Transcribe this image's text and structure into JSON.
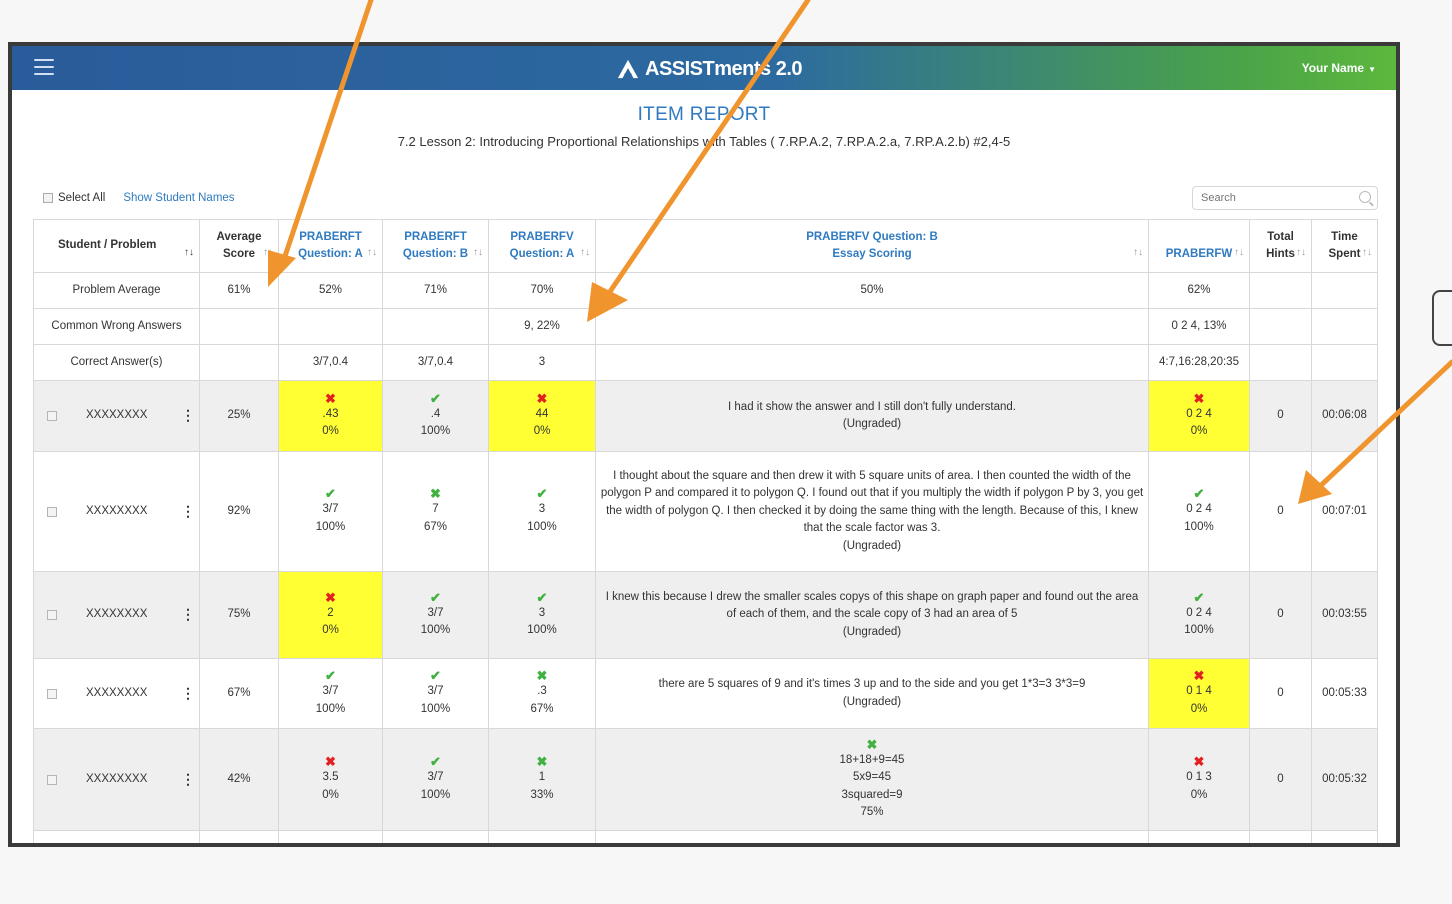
{
  "app": {
    "brand_bold": "ASSISTments",
    "brand_version": "2.0",
    "user_name": "Your Name"
  },
  "report": {
    "title": "ITEM REPORT",
    "subtitle": "7.2 Lesson 2: Introducing Proportional Relationships with Tables ( 7.RP.A.2, 7.RP.A.2.a, 7.RP.A.2.b) #2,4-5"
  },
  "controls": {
    "select_all": "Select All",
    "show_names": "Show Student Names",
    "search_placeholder": "Search"
  },
  "columns": {
    "student": "Student / Problem",
    "avg_l1": "Average",
    "avg_l2": "Score",
    "q1_l1": "PRABERFT",
    "q1_l2": "Question: A",
    "q2_l1": "PRABERFT",
    "q2_l2": "Question: B",
    "q3_l1": "PRABERFV",
    "q3_l2": "Question: A",
    "q4_l1": "PRABERFV Question: B",
    "q4_l2": "Essay Scoring",
    "q5": "PRABERFW",
    "hints_l1": "Total",
    "hints_l2": "Hints",
    "time_l1": "Time",
    "time_l2": "Spent",
    "sort_icon": "↑↓"
  },
  "summary": {
    "problem_average": {
      "label": "Problem Average",
      "avg": "61%",
      "q1": "52%",
      "q2": "71%",
      "q3": "70%",
      "q4": "50%",
      "q5": "62%"
    },
    "common_wrong": {
      "label": "Common Wrong Answers",
      "q3": "9, 22%",
      "q5": "0 2 4, 13%"
    },
    "correct": {
      "label": "Correct Answer(s)",
      "q1": "3/7,0.4",
      "q2": "3/7,0.4",
      "q3": "3",
      "q5": "4:7,16:28,20:35"
    }
  },
  "icons": {
    "check": "✔",
    "cross": "✖",
    "kebab": "⋮",
    "caret": "▼"
  },
  "students": [
    {
      "name": "XXXXXXXX",
      "avg": "25%",
      "q1": {
        "answer": ".43",
        "score": "0%"
      },
      "q2": {
        "answer": ".4",
        "score": "100%"
      },
      "q3": {
        "answer": "44",
        "score": "0%"
      },
      "q4": {
        "text": "I had it show the answer and I still don't fully understand.",
        "status": "(Ungraded)"
      },
      "q5": {
        "answer": "0 2 4",
        "score": "0%"
      },
      "hints": "0",
      "time": "00:06:08"
    },
    {
      "name": "XXXXXXXX",
      "avg": "92%",
      "q1": {
        "answer": "3/7",
        "score": "100%"
      },
      "q2": {
        "answer": "7",
        "score": "67%"
      },
      "q3": {
        "answer": "3",
        "score": "100%"
      },
      "q4": {
        "text": "I thought about the square and then drew it with 5 square units of area. I then counted the width of the polygon P and compared it to polygon Q. I found out that if you multiply the width if polygon P by 3, you get the width of polygon Q. I then checked it by doing the same thing with the length. Because of this, I knew that the scale factor was 3.",
        "status": "(Ungraded)"
      },
      "q5": {
        "answer": "0 2 4",
        "score": "100%"
      },
      "hints": "0",
      "time": "00:07:01"
    },
    {
      "name": "XXXXXXXX",
      "avg": "75%",
      "q1": {
        "answer": "2",
        "score": "0%"
      },
      "q2": {
        "answer": "3/7",
        "score": "100%"
      },
      "q3": {
        "answer": "3",
        "score": "100%"
      },
      "q4": {
        "text": "I knew this because I drew the smaller scales copys of this shape on graph paper and found out the area of each of them, and the scale copy of 3 had an area of 5",
        "status": "(Ungraded)"
      },
      "q5": {
        "answer": "0 2 4",
        "score": "100%"
      },
      "hints": "0",
      "time": "00:03:55"
    },
    {
      "name": "XXXXXXXX",
      "avg": "67%",
      "q1": {
        "answer": "3/7",
        "score": "100%"
      },
      "q2": {
        "answer": "3/7",
        "score": "100%"
      },
      "q3": {
        "answer": ".3",
        "score": "67%"
      },
      "q4": {
        "text": "there are 5 squares of 9 and it's times 3 up and to the side and you get 1*3=3 3*3=9",
        "status": "(Ungraded)"
      },
      "q5": {
        "answer": "0 1 4",
        "score": "0%"
      },
      "hints": "0",
      "time": "00:05:33"
    },
    {
      "name": "XXXXXXXX",
      "avg": "42%",
      "q1": {
        "answer": "3.5",
        "score": "0%"
      },
      "q2": {
        "answer": "3/7",
        "score": "100%"
      },
      "q3": {
        "answer": "1",
        "score": "33%"
      },
      "q4": {
        "line1": "18+18+9=45",
        "line2": "5x9=45",
        "line3": "3squared=9",
        "score": "75%"
      },
      "q5": {
        "answer": "0 1 3",
        "score": "0%"
      },
      "hints": "0",
      "time": "00:05:32"
    }
  ]
}
